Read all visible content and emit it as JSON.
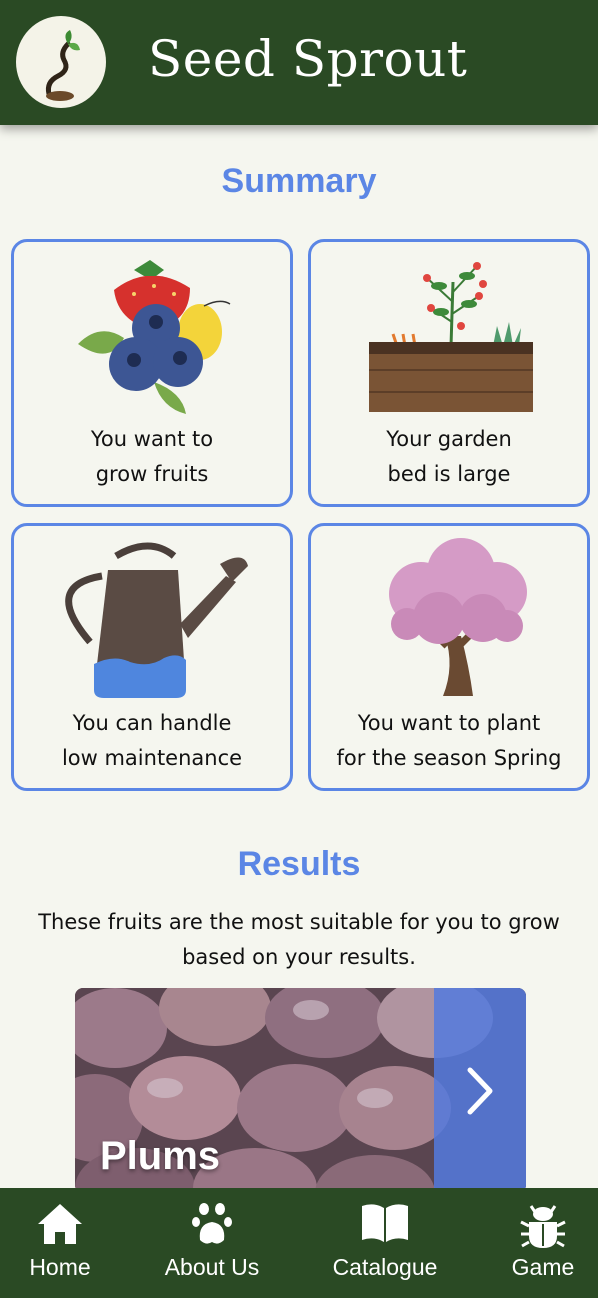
{
  "app": {
    "title": "Seed Sprout"
  },
  "colors": {
    "header": "#2a4a24",
    "accent": "#5b86e5",
    "background": "#f5f6ef"
  },
  "summary": {
    "heading": "Summary",
    "cards": [
      {
        "icon": "fruits-icon",
        "line1": "You want to",
        "line2": "grow fruits"
      },
      {
        "icon": "garden-bed-icon",
        "line1": "Your garden",
        "line2": "bed is large"
      },
      {
        "icon": "watering-can-icon",
        "line1": "You can handle",
        "line2": "low maintenance"
      },
      {
        "icon": "blossom-tree-icon",
        "line1": "You want to plant",
        "line2": "for the season Spring"
      }
    ]
  },
  "results": {
    "heading": "Results",
    "description_line1": "These fruits are the most suitable for you to grow",
    "description_line2": "based on your results.",
    "items": [
      {
        "name": "Plums"
      }
    ],
    "next_icon": "chevron-right-icon"
  },
  "nav": {
    "items": [
      {
        "label": "Home",
        "icon": "home-icon"
      },
      {
        "label": "About Us",
        "icon": "paw-icon"
      },
      {
        "label": "Catalogue",
        "icon": "book-icon"
      },
      {
        "label": "Game",
        "icon": "bug-icon"
      }
    ]
  }
}
